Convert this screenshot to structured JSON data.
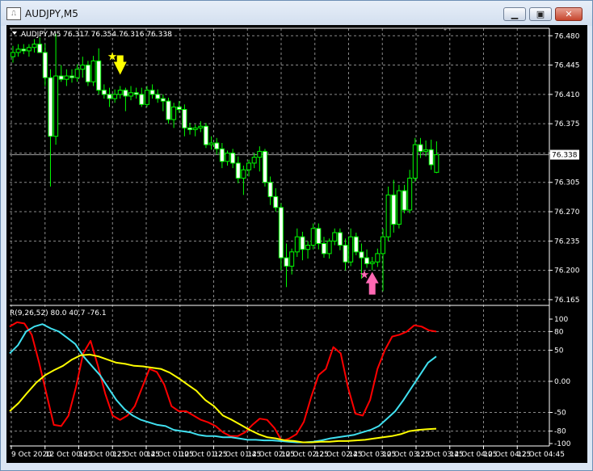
{
  "window": {
    "title": "AUDJPY,M5",
    "buttons": [
      "minimize",
      "maximize",
      "close"
    ]
  },
  "colors": {
    "background": "#000000",
    "grid": "#8a8a8a",
    "candle_up_body": "#000000",
    "candle_down_body": "#ffffff",
    "candle_wick": "#00ff00",
    "red_line": "#ff0000",
    "cyan_line": "#40e0f0",
    "yellow_line": "#ffff00",
    "sell_arrow": "#ffff00",
    "buy_arrow": "#ff69b4"
  },
  "chart_data": [
    {
      "type": "candlestick",
      "symbol_label": "AUDJPY,M5",
      "ohlc_label": "76.317 76.354 76.316 76.338",
      "current_price": "76.338",
      "y_ticks": [
        "76.480",
        "76.445",
        "76.410",
        "76.375",
        "76.340",
        "76.305",
        "76.270",
        "76.235",
        "76.200",
        "76.165"
      ],
      "ylim": [
        76.163,
        76.487
      ],
      "x_ticks": [
        "9 Oct 2020",
        "12 Oct 00:05",
        "12 Oct 00:25",
        "12 Oct 00:45",
        "12 Oct 01:05",
        "12 Oct 01:25",
        "12 Oct 01:45",
        "12 Oct 02:05",
        "12 Oct 02:25",
        "12 Oct 02:45",
        "12 Oct 03:05",
        "12 Oct 03:25",
        "12 Oct 03:45",
        "12 Oct 04:05",
        "12 Oct 04:25",
        "12 Oct 04:45"
      ],
      "candles": [
        [
          76.455,
          76.468,
          76.448,
          76.46
        ],
        [
          76.46,
          76.47,
          76.455,
          76.464
        ],
        [
          76.464,
          76.47,
          76.458,
          76.462
        ],
        [
          76.462,
          76.47,
          76.455,
          76.466
        ],
        [
          76.466,
          76.476,
          76.46,
          76.47
        ],
        [
          76.47,
          76.478,
          76.464,
          76.46
        ],
        [
          76.46,
          76.47,
          76.42,
          76.43
        ],
        [
          76.43,
          76.44,
          76.3,
          76.36
        ],
        [
          76.36,
          76.482,
          76.35,
          76.432
        ],
        [
          76.432,
          76.445,
          76.425,
          76.428
        ],
        [
          76.428,
          76.44,
          76.42,
          76.432
        ],
        [
          76.432,
          76.44,
          76.424,
          76.43
        ],
        [
          76.43,
          76.446,
          76.425,
          76.44
        ],
        [
          76.44,
          76.455,
          76.43,
          76.445
        ],
        [
          76.445,
          76.45,
          76.42,
          76.425
        ],
        [
          76.425,
          76.456,
          76.42,
          76.45
        ],
        [
          76.45,
          76.465,
          76.41,
          76.415
        ],
        [
          76.415,
          76.422,
          76.405,
          76.41
        ],
        [
          76.41,
          76.418,
          76.395,
          76.405
        ],
        [
          76.405,
          76.416,
          76.4,
          76.41
        ],
        [
          76.41,
          76.42,
          76.405,
          76.415
        ],
        [
          76.415,
          76.418,
          76.39,
          76.408
        ],
        [
          76.408,
          76.42,
          76.403,
          76.412
        ],
        [
          76.412,
          76.418,
          76.405,
          76.41
        ],
        [
          76.41,
          76.418,
          76.395,
          76.398
        ],
        [
          76.398,
          76.42,
          76.395,
          76.415
        ],
        [
          76.415,
          76.422,
          76.405,
          76.41
        ],
        [
          76.41,
          76.416,
          76.4,
          76.405
        ],
        [
          76.405,
          76.41,
          76.39,
          76.402
        ],
        [
          76.402,
          76.406,
          76.375,
          76.38
        ],
        [
          76.38,
          76.4,
          76.37,
          76.395
        ],
        [
          76.395,
          76.402,
          76.388,
          76.392
        ],
        [
          76.392,
          76.398,
          76.36,
          76.37
        ],
        [
          76.37,
          76.376,
          76.362,
          76.368
        ],
        [
          76.368,
          76.374,
          76.36,
          76.37
        ],
        [
          76.37,
          76.378,
          76.365,
          76.372
        ],
        [
          76.372,
          76.376,
          76.346,
          76.35
        ],
        [
          76.35,
          76.36,
          76.344,
          76.352
        ],
        [
          76.352,
          76.358,
          76.338,
          76.345
        ],
        [
          76.345,
          76.352,
          76.322,
          76.33
        ],
        [
          76.33,
          76.343,
          76.325,
          76.34
        ],
        [
          76.34,
          76.345,
          76.322,
          76.328
        ],
        [
          76.328,
          76.336,
          76.304,
          76.31
        ],
        [
          76.31,
          76.325,
          76.29,
          76.32
        ],
        [
          76.32,
          76.332,
          76.312,
          76.328
        ],
        [
          76.328,
          76.34,
          76.322,
          76.335
        ],
        [
          76.335,
          76.348,
          76.318,
          76.342
        ],
        [
          76.342,
          76.345,
          76.3,
          76.305
        ],
        [
          76.305,
          76.312,
          76.278,
          76.288
        ],
        [
          76.288,
          76.298,
          76.27,
          76.275
        ],
        [
          76.275,
          76.28,
          76.2,
          76.215
        ],
        [
          76.215,
          76.232,
          76.18,
          76.205
        ],
        [
          76.205,
          76.226,
          76.195,
          76.222
        ],
        [
          76.222,
          76.25,
          76.216,
          76.24
        ],
        [
          76.24,
          76.246,
          76.212,
          76.225
        ],
        [
          76.225,
          76.235,
          76.214,
          76.23
        ],
        [
          76.23,
          76.256,
          76.225,
          76.25
        ],
        [
          76.25,
          76.256,
          76.225,
          76.232
        ],
        [
          76.232,
          76.24,
          76.215,
          76.22
        ],
        [
          76.22,
          76.238,
          76.214,
          76.235
        ],
        [
          76.235,
          76.25,
          76.23,
          76.245
        ],
        [
          76.245,
          76.25,
          76.224,
          76.23
        ],
        [
          76.23,
          76.238,
          76.2,
          76.21
        ],
        [
          76.21,
          76.25,
          76.205,
          76.24
        ],
        [
          76.24,
          76.245,
          76.218,
          76.222
        ],
        [
          76.222,
          76.232,
          76.19,
          76.215
        ],
        [
          76.215,
          76.225,
          76.203,
          76.208
        ],
        [
          76.208,
          76.216,
          76.2,
          76.21
        ],
        [
          76.21,
          76.226,
          76.204,
          76.22
        ],
        [
          76.22,
          76.25,
          76.175,
          76.24
        ],
        [
          76.24,
          76.3,
          76.235,
          76.29
        ],
        [
          76.29,
          76.308,
          76.245,
          76.255
        ],
        [
          76.255,
          76.302,
          76.25,
          76.295
        ],
        [
          76.295,
          76.302,
          76.268,
          76.272
        ],
        [
          76.272,
          76.32,
          76.268,
          76.31
        ],
        [
          76.31,
          76.358,
          76.306,
          76.35
        ],
        [
          76.35,
          76.358,
          76.334,
          76.342
        ],
        [
          76.342,
          76.355,
          76.336,
          76.344
        ],
        [
          76.344,
          76.356,
          76.32,
          76.326
        ],
        [
          76.317,
          76.354,
          76.316,
          76.338
        ]
      ],
      "signals": [
        {
          "type": "sell",
          "candle_index": 20
        },
        {
          "type": "buy",
          "candle_index": 67
        }
      ]
    },
    {
      "type": "line",
      "indicator_label": "R(9,26,52) 80.0 40.7 -76.1",
      "y_ticks": [
        "100",
        "80",
        "50",
        "0.00",
        "-50",
        "-80",
        "-100"
      ],
      "ylim": [
        -100,
        100
      ],
      "series": [
        {
          "color": "#ff0000",
          "values": [
            88,
            95,
            93,
            75,
            30,
            -20,
            -70,
            -72,
            -55,
            -10,
            45,
            65,
            25,
            -20,
            -55,
            -62,
            -55,
            -40,
            -10,
            20,
            15,
            -5,
            -40,
            -48,
            -48,
            -55,
            -62,
            -66,
            -72,
            -82,
            -88,
            -88,
            -82,
            -70,
            -60,
            -62,
            -75,
            -96,
            -92,
            -85,
            -65,
            -25,
            10,
            20,
            55,
            45,
            -10,
            -52,
            -55,
            -30,
            20,
            50,
            72,
            75,
            80,
            90,
            88,
            82,
            80
          ]
        },
        {
          "color": "#40e0f0",
          "values": [
            45,
            58,
            80,
            88,
            92,
            85,
            80,
            70,
            60,
            40,
            25,
            10,
            -10,
            -30,
            -45,
            -55,
            -62,
            -66,
            -70,
            -72,
            -78,
            -80,
            -82,
            -86,
            -88,
            -88,
            -90,
            -90,
            -92,
            -94,
            -94,
            -95,
            -95,
            -96,
            -97,
            -98,
            -98,
            -97,
            -95,
            -92,
            -90,
            -88,
            -86,
            -82,
            -78,
            -72,
            -60,
            -48,
            -30,
            -10,
            10,
            30,
            40
          ]
        },
        {
          "color": "#ffff00",
          "values": [
            -48,
            -35,
            -18,
            -2,
            10,
            18,
            25,
            35,
            42,
            43,
            40,
            35,
            30,
            28,
            25,
            24,
            22,
            20,
            14,
            5,
            -5,
            -15,
            -30,
            -40,
            -55,
            -62,
            -70,
            -78,
            -85,
            -90,
            -92,
            -95,
            -96,
            -98,
            -98,
            -97,
            -97,
            -96,
            -96,
            -95,
            -94,
            -92,
            -90,
            -88,
            -85,
            -80,
            -78,
            -77,
            -76.1
          ]
        }
      ]
    }
  ]
}
